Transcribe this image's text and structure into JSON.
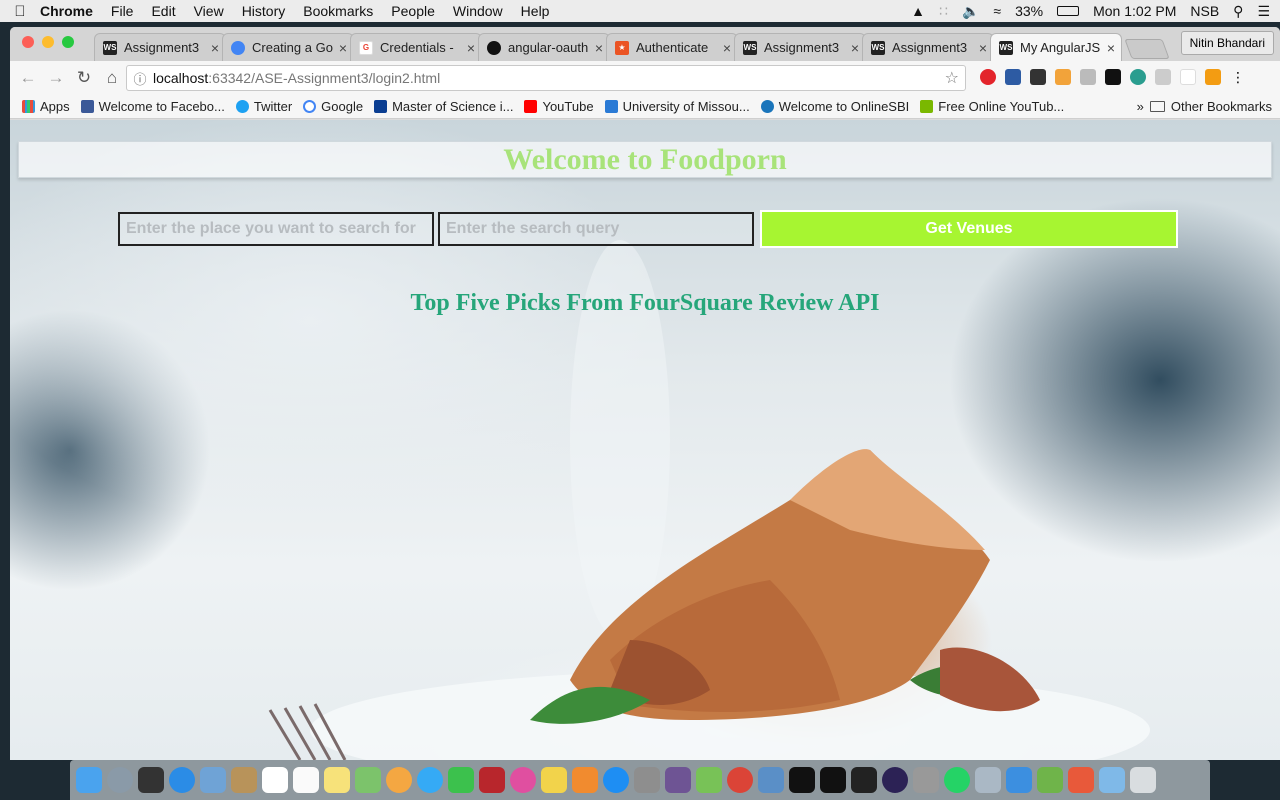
{
  "menubar": {
    "app_name": "Chrome",
    "menus": [
      "File",
      "Edit",
      "View",
      "History",
      "Bookmarks",
      "People",
      "Window",
      "Help"
    ],
    "battery": "33%",
    "clock": "Mon 1:02 PM",
    "user": "NSB"
  },
  "tabs": [
    {
      "title": "Assignment3",
      "favicon": "webstorm-icon",
      "color": "#222222"
    },
    {
      "title": "Creating a Go",
      "favicon": "google-circle-icon",
      "color": "#4285f4"
    },
    {
      "title": "Credentials -",
      "favicon": "google-g-icon",
      "color": "#ea4335"
    },
    {
      "title": "angular-oauth",
      "favicon": "github-icon",
      "color": "#111111"
    },
    {
      "title": "Authenticate",
      "favicon": "auth0-icon",
      "color": "#eb5424"
    },
    {
      "title": "Assignment3",
      "favicon": "webstorm-icon",
      "color": "#222222"
    },
    {
      "title": "Assignment3",
      "favicon": "webstorm-icon",
      "color": "#222222"
    },
    {
      "title": "My AngularJS",
      "favicon": "webstorm-icon",
      "color": "#222222"
    }
  ],
  "profile_name": "Nitin Bhandari",
  "address": {
    "host": "localhost",
    "path": ":63342/ASE-Assignment3/login2.html"
  },
  "bookmarks": [
    {
      "label": "Apps",
      "icon": "apps-grid-icon",
      "color": "#e74c3c"
    },
    {
      "label": "Welcome to Facebo...",
      "icon": "facebook-icon",
      "color": "#3b5998"
    },
    {
      "label": "Twitter",
      "icon": "twitter-icon",
      "color": "#1da1f2"
    },
    {
      "label": "Google",
      "icon": "google-g-icon",
      "color": "#4285f4"
    },
    {
      "label": "Master of Science i...",
      "icon": "umkc-icon",
      "color": "#0a3d91"
    },
    {
      "label": "YouTube",
      "icon": "youtube-icon",
      "color": "#ff0000"
    },
    {
      "label": "University of Missou...",
      "icon": "university-icon",
      "color": "#2a7ad5"
    },
    {
      "label": "Welcome to OnlineSBI",
      "icon": "sbi-icon",
      "color": "#1a75bb"
    },
    {
      "label": "Free Online YouTub...",
      "icon": "download-arrow-icon",
      "color": "#7ab800"
    }
  ],
  "other_bookmarks": "Other Bookmarks",
  "page": {
    "title": "Welcome to Foodporn",
    "place_placeholder": "Enter the place you want to search for",
    "query_placeholder": "Enter the search query",
    "button_label": "Get Venues",
    "subheading": "Top Five Picks From FourSquare Review API"
  },
  "colors": {
    "title": "#a8e37a",
    "button": "#a7f531",
    "subheading": "#26a67a"
  }
}
